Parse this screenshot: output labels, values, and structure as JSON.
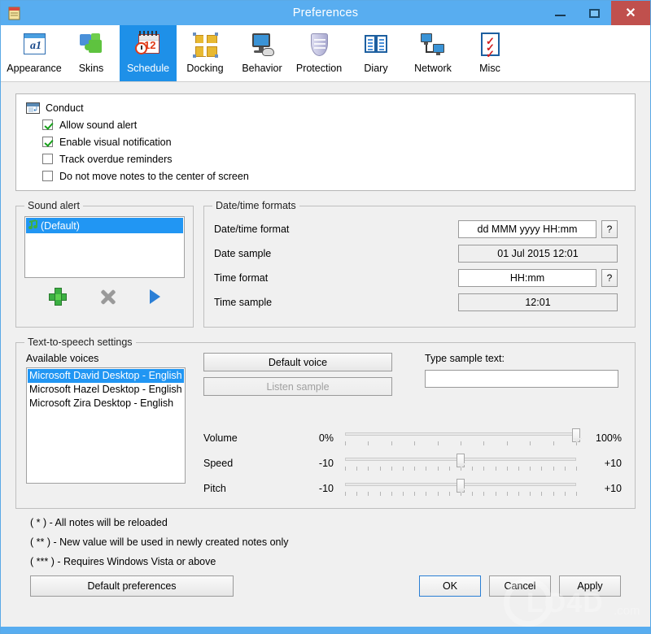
{
  "window": {
    "title": "Preferences",
    "icon": "notepad-icon",
    "minimize_label": "–",
    "maximize_label": "□",
    "close_label": "✕"
  },
  "toolbar": {
    "tabs": [
      {
        "label": "Appearance",
        "icon": "appearance-icon",
        "selected": false
      },
      {
        "label": "Skins",
        "icon": "skins-icon",
        "selected": false
      },
      {
        "label": "Schedule",
        "icon": "schedule-icon",
        "selected": true
      },
      {
        "label": "Docking",
        "icon": "docking-icon",
        "selected": false
      },
      {
        "label": "Behavior",
        "icon": "behavior-icon",
        "selected": false
      },
      {
        "label": "Protection",
        "icon": "protection-icon",
        "selected": false
      },
      {
        "label": "Diary",
        "icon": "diary-icon",
        "selected": false
      },
      {
        "label": "Network",
        "icon": "network-icon",
        "selected": false
      },
      {
        "label": "Misc",
        "icon": "misc-icon",
        "selected": false
      }
    ]
  },
  "conduct": {
    "title": "Conduct",
    "items": [
      {
        "label": "Allow sound alert",
        "checked": true
      },
      {
        "label": "Enable visual notification",
        "checked": true
      },
      {
        "label": "Track overdue reminders",
        "checked": false
      },
      {
        "label": "Do not move notes to the center of screen",
        "checked": false
      }
    ]
  },
  "sound_alert": {
    "legend": "Sound alert",
    "items": [
      {
        "label": "(Default)",
        "selected": true
      }
    ],
    "buttons": [
      {
        "name": "add-sound-button",
        "icon": "plus-icon"
      },
      {
        "name": "remove-sound-button",
        "icon": "x-icon"
      },
      {
        "name": "play-sound-button",
        "icon": "play-icon"
      }
    ]
  },
  "datetime": {
    "legend": "Date/time formats",
    "rows": [
      {
        "label": "Date/time format",
        "value": "dd MMM yyyy HH:mm",
        "editable": true,
        "help": "?"
      },
      {
        "label": "Date sample",
        "value": "01 Jul 2015 12:01",
        "editable": false
      },
      {
        "label": "Time format",
        "value": "HH:mm",
        "editable": true,
        "help": "?"
      },
      {
        "label": "Time sample",
        "value": "12:01",
        "editable": false
      }
    ]
  },
  "tts": {
    "legend": "Text-to-speech settings",
    "voices_label": "Available voices",
    "voices": [
      {
        "label": "Microsoft David Desktop - English",
        "selected": true
      },
      {
        "label": "Microsoft Hazel Desktop - English",
        "selected": false
      },
      {
        "label": "Microsoft Zira Desktop - English",
        "selected": false
      }
    ],
    "default_voice_button": "Default voice",
    "listen_sample_button": "Listen sample",
    "sample_label": "Type sample text:",
    "sample_value": "",
    "sample_placeholder": "",
    "sliders": [
      {
        "name": "Volume",
        "min_label": "0%",
        "max_label": "100%",
        "value": 100,
        "ticks": 11
      },
      {
        "name": "Speed",
        "min_label": "-10",
        "max_label": "+10",
        "value": 50,
        "ticks": 21
      },
      {
        "name": "Pitch",
        "min_label": "-10",
        "max_label": "+10",
        "value": 50,
        "ticks": 21
      }
    ]
  },
  "footer": {
    "notes": [
      "( * ) - All notes will be reloaded",
      "( ** ) - New value will be used in newly created notes only",
      "( *** ) - Requires Windows Vista or above"
    ],
    "default_preferences_button": "Default preferences",
    "ok_button": "OK",
    "cancel_button": "Cancel",
    "apply_button": "Apply"
  },
  "watermark": {
    "text": "LO4D",
    "suffix": ".com"
  },
  "colors": {
    "title_bar": "#58adf0",
    "accent_selected_tab": "#1e90e8",
    "close_button": "#c0504d",
    "selection_blue": "#2196f3",
    "checkmark_green": "#17a01a"
  }
}
